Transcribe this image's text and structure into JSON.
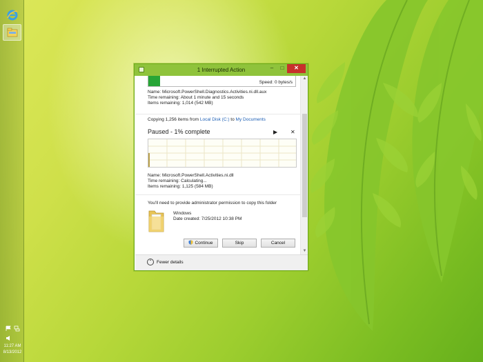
{
  "taskbar": {
    "clock_time": "11:27 AM",
    "clock_date": "8/13/2012",
    "icons": [
      "ie-icon",
      "file-explorer-icon",
      "flag-icon",
      "network-icon",
      "speaker-icon"
    ]
  },
  "dialog": {
    "title": "1 Interrupted Action",
    "controls": {
      "minimize": "–",
      "maximize": "□",
      "close": "✕"
    },
    "first_copy": {
      "speed": "Speed: 0 bytes/s",
      "name": "Name:  Microsoft.PowerShell.Diagnostics.Activities.ni.dll.aux",
      "time_remaining": "Time remaining:  About 1 minute and 15 seconds",
      "items_remaining": "Items remaining:  1,014 (542 MB)",
      "progress_fraction": 0.08
    },
    "second_copy": {
      "copying_prefix": "Copying 1,256 items from ",
      "source": "Local Disk (C:)",
      "to_word": " to ",
      "destination": "My Documents",
      "status": "Paused - 1% complete",
      "resume_glyph": "▶",
      "cancel_glyph": "✕",
      "progress_percent": 1,
      "name": "Name:  Microsoft.PowerShell.Activities.ni.dll",
      "time_remaining": "Time remaining:  Calculating...",
      "items_remaining": "Items remaining:  1,125 (584 MB)"
    },
    "permission": {
      "message": "You'll need to provide administrator permission to copy this folder",
      "folder_name": "Windows",
      "date_created": "Date created: 7/25/2012 10:38 PM",
      "continue_label": "Continue",
      "skip_label": "Skip",
      "cancel_label": "Cancel"
    },
    "footer": {
      "label": "Fewer details",
      "glyph": "⌃"
    }
  },
  "colors": {
    "titlebar": "#8fc33b",
    "progress_green": "#27a536",
    "close_red": "#c7312b",
    "link_blue": "#1d5fb5"
  }
}
